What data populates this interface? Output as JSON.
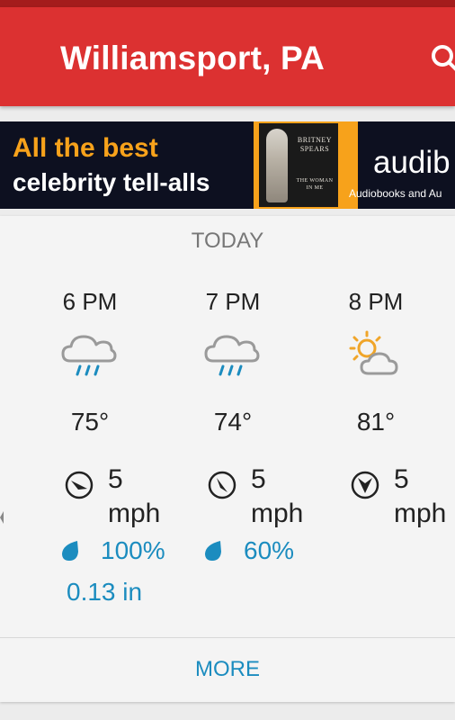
{
  "header": {
    "city": "Williamsport, PA",
    "search_icon": "search-icon",
    "bar_color": "#dc3131"
  },
  "ad": {
    "line1": "All the best",
    "line2": "celebrity tell-alls",
    "book_title": "BRITNEY SPEARS",
    "book_subtitle": "THE WOMAN IN ME",
    "brand": "audib",
    "tagline": "Audiobooks and Au",
    "accent": "#f7a21b"
  },
  "forecast": {
    "day_label": "TODAY",
    "hours": [
      {
        "time": "6 PM",
        "condition_icon": "rain-cloud-icon",
        "temp": "75°",
        "wind_icon": "wind-direction-icon",
        "wind_speed": "5",
        "wind_unit": "mph",
        "precip_pct": "100%",
        "precip_amount": "0.13 in"
      },
      {
        "time": "7 PM",
        "condition_icon": "rain-cloud-icon",
        "temp": "74°",
        "wind_icon": "wind-direction-icon",
        "wind_speed": "5",
        "wind_unit": "mph",
        "precip_pct": "60%",
        "precip_amount": ""
      },
      {
        "time": "8 PM",
        "condition_icon": "partly-sunny-icon",
        "temp": "81°",
        "wind_icon": "wind-direction-icon",
        "wind_speed": "5",
        "wind_unit": "mph",
        "precip_pct": "",
        "precip_amount": ""
      }
    ],
    "more_label": "MORE",
    "precip_color": "#1b8cbf"
  }
}
